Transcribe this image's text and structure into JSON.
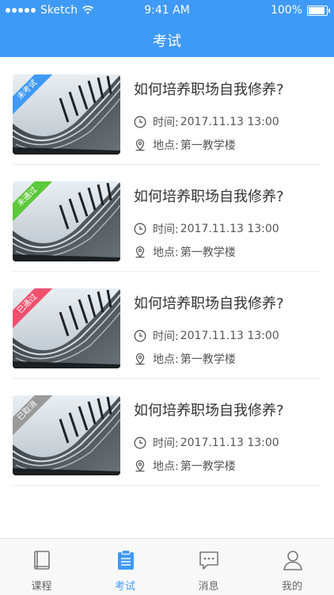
{
  "status_bar": {
    "carrier": "Sketch",
    "time": "9:41 AM",
    "battery": "100%",
    "battery_level": 1.0
  },
  "header": {
    "title": "考试"
  },
  "exams": [
    {
      "badge": "未考试",
      "badge_color": "#3f9af7",
      "title": "如何培养职场自我修养?",
      "time_label": "时间:",
      "time_value": "2017.11.13 13:00",
      "location_label": "地点:",
      "location_value": "第一教学楼"
    },
    {
      "badge": "未通过",
      "badge_color": "#5cc83a",
      "title": "如何培养职场自我修养?",
      "time_label": "时间:",
      "time_value": "2017.11.13 13:00",
      "location_label": "地点:",
      "location_value": "第一教学楼"
    },
    {
      "badge": "已通过",
      "badge_color": "#f0506e",
      "title": "如何培养职场自我修养?",
      "time_label": "时间:",
      "time_value": "2017.11.13 13:00",
      "location_label": "地点:",
      "location_value": "第一教学楼"
    },
    {
      "badge": "已取消",
      "badge_color": "#9a9a9a",
      "title": "如何培养职场自我修养?",
      "time_label": "时间:",
      "time_value": "2017.11.13 13:00",
      "location_label": "地点:",
      "location_value": "第一教学楼"
    }
  ],
  "tabbar": {
    "active": "exam",
    "accent_color": "#3f9af7",
    "items": [
      {
        "key": "course",
        "label": "课程",
        "icon": "book-icon"
      },
      {
        "key": "exam",
        "label": "考试",
        "icon": "clipboard-icon"
      },
      {
        "key": "messages",
        "label": "消息",
        "icon": "chat-bubble-icon"
      },
      {
        "key": "me",
        "label": "我的",
        "icon": "person-icon"
      }
    ]
  }
}
